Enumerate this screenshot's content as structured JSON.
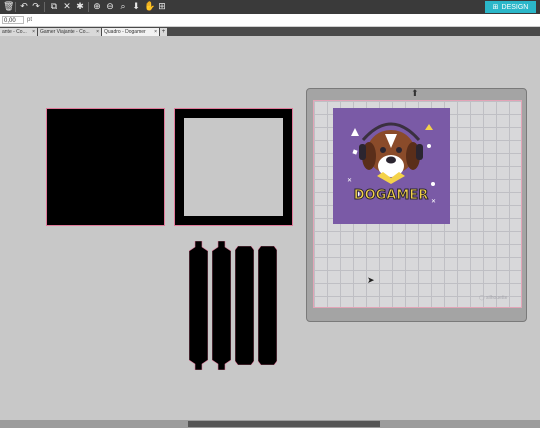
{
  "toolbar": {
    "icons": [
      "trash-icon",
      "undo-icon",
      "redo-icon",
      "group-icon",
      "ungroup-icon",
      "weld-icon",
      "zoom-in-icon",
      "zoom-out-icon",
      "zoom-fit-icon",
      "move-down-icon",
      "pan-icon",
      "page-view-icon"
    ],
    "design_label": "DESIGN"
  },
  "options": {
    "value": "0,00",
    "unit": "pt"
  },
  "tabs": [
    {
      "label": "ante - Co...",
      "close": "×"
    },
    {
      "label": "Gamer Viajante - Co...",
      "close": "×"
    },
    {
      "label": "Quadro - Dogamer",
      "close": "×",
      "active": true
    }
  ],
  "tab_add": "+",
  "artwork": {
    "text": "DOGAMER",
    "background": "#7a5aa6"
  },
  "mat": {
    "logo": "silhouette"
  },
  "colors": {
    "accent": "#2bb7c9",
    "toolbar": "#3a3a3a",
    "cut_line": "#e07a9a"
  }
}
